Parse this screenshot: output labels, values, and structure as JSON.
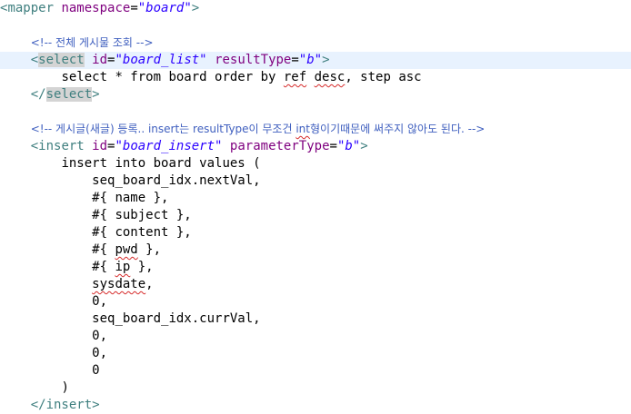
{
  "code": {
    "l0": {
      "lt": "<",
      "tag": "mapper",
      "sp": " ",
      "attr": "namespace",
      "eq": "=",
      "val": "\"board\"",
      "gt": ">"
    },
    "l2": {
      "indent": "    ",
      "comment": "<!-- 전체 게시물 조회 -->"
    },
    "l3": {
      "indent": "    ",
      "lt": "<",
      "tag": "select",
      "sp1": " ",
      "attr1": "id",
      "eq1": "=",
      "val1": "\"board_list\"",
      "sp2": " ",
      "attr2": "resultType",
      "eq2": "=",
      "val2": "\"b\"",
      "gt": ">"
    },
    "l4": {
      "indent": "        ",
      "pre": "select * from board order by ",
      "w1": "ref",
      "sp": " ",
      "w2": "desc",
      "post": ", step asc"
    },
    "l5": {
      "indent": "    ",
      "lt": "</",
      "tag": "select",
      "gt": ">"
    },
    "l7": {
      "indent": "    ",
      "c1": "<!-- 게시글(새글) 등록.. insert는 resultType이 무조건 ",
      "w": "int",
      "c2": "형이기때문에 써주지 않아도 된다. -->"
    },
    "l8": {
      "indent": "    ",
      "lt": "<",
      "tag": "insert",
      "sp1": " ",
      "attr1": "id",
      "eq1": "=",
      "val1": "\"board_insert\"",
      "sp2": " ",
      "attr2": "parameterType",
      "eq2": "=",
      "val2": "\"b\"",
      "gt": ">"
    },
    "l9": {
      "indent": "        ",
      "text": "insert into board values ("
    },
    "l10": {
      "indent": "            ",
      "text": "seq_board_idx.nextVal,"
    },
    "l11": {
      "indent": "            ",
      "text": "#{ name },"
    },
    "l12": {
      "indent": "            ",
      "text": "#{ subject },"
    },
    "l13": {
      "indent": "            ",
      "text": "#{ content },"
    },
    "l14": {
      "indent": "            ",
      "pre": "#{ ",
      "w": "pwd",
      "post": " },"
    },
    "l15": {
      "indent": "            ",
      "pre": "#{ ",
      "w": "ip",
      "post": " },"
    },
    "l16": {
      "indent": "            ",
      "w": "sysdate",
      "post": ","
    },
    "l17": {
      "indent": "            ",
      "text": "0,"
    },
    "l18": {
      "indent": "            ",
      "text": "seq_board_idx.currVal,"
    },
    "l19": {
      "indent": "            ",
      "text": "0,"
    },
    "l20": {
      "indent": "            ",
      "text": "0,"
    },
    "l21": {
      "indent": "            ",
      "text": "0"
    },
    "l22": {
      "indent": "        ",
      "text": ")"
    },
    "l23": {
      "indent": "    ",
      "lt": "</",
      "tag": "insert",
      "gt": ">"
    }
  },
  "colors": {
    "tag": "#3f7f7f",
    "attribute": "#7f007f",
    "string": "#2a00ff",
    "comment": "#3f5fbf",
    "current_line": "#e8f2fe",
    "match_highlight": "#d4d4d4",
    "spell_error": "#d62b2b"
  }
}
